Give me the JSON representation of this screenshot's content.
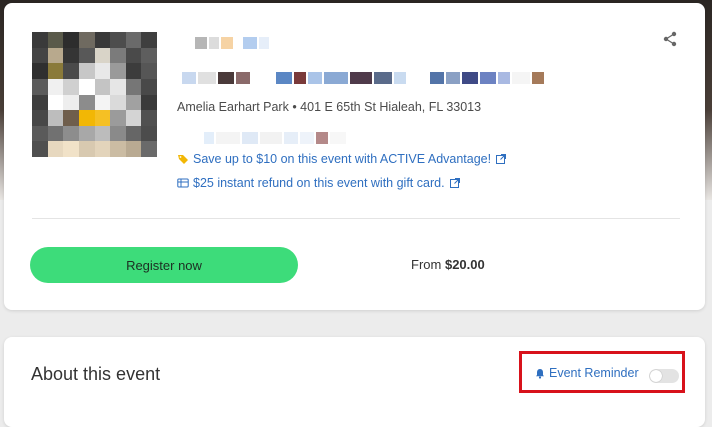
{
  "event": {
    "location": "Amelia Earhart Park • 401 E 65th St Hialeah, FL  33013",
    "advantage_promo": "Save up to $10 on this event with ACTIVE Advantage!",
    "gift_card_promo": "$25 instant refund on this event with gift card.",
    "register_label": "Register now",
    "price_prefix": "From",
    "price_value": "$20.00"
  },
  "about": {
    "title": "About this event",
    "reminder_label": "Event Reminder",
    "reminder_on": false
  },
  "colors": {
    "link_blue": "#2f6fc0",
    "register_green": "#3ddc7a",
    "highlight_red": "#d8121b"
  },
  "icons": {
    "share": "share-icon",
    "advantage": "advantage-tag-icon",
    "gift": "gift-card-icon",
    "external": "external-link-icon",
    "bell": "bell-icon"
  }
}
